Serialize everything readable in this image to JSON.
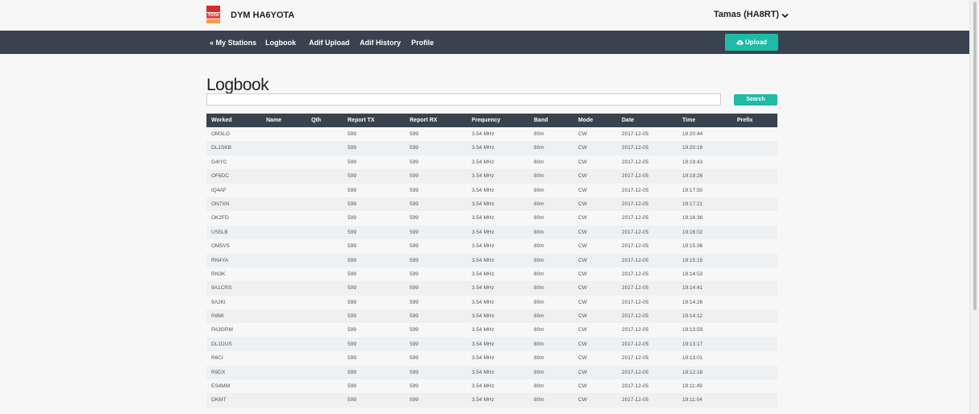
{
  "app": {
    "logo_text": "YOTA",
    "title": "DYM HA6YOTA",
    "user": "Tamas (HA8RT)"
  },
  "nav": {
    "items": [
      "« My Stations",
      "Logbook",
      "Adif Upload",
      "Adif History",
      "Profile"
    ],
    "upload_label": "Upload"
  },
  "page": {
    "title": "Logbook",
    "search_value": "",
    "search_button": "Search"
  },
  "colors": {
    "navbar": "#39424e",
    "accent": "#1fbba6",
    "row_alt": "#eef0f2"
  },
  "table": {
    "columns": [
      "Worked",
      "Name",
      "Qth",
      "Report TX",
      "Report RX",
      "Frequency",
      "Band",
      "Mode",
      "Date",
      "Time",
      "Prefix"
    ],
    "rows": [
      [
        "OM3LO",
        "",
        "",
        "599",
        "599",
        "3.54 MHz",
        "80m",
        "CW",
        "2017-12-05",
        "19:20:44",
        ""
      ],
      [
        "DL1SKB",
        "",
        "",
        "599",
        "599",
        "3.54 MHz",
        "80m",
        "CW",
        "2017-12-05",
        "19:20:19",
        ""
      ],
      [
        "G4IYC",
        "",
        "",
        "599",
        "599",
        "3.54 MHz",
        "80m",
        "CW",
        "2017-12-05",
        "19:19:43",
        ""
      ],
      [
        "OF6DC",
        "",
        "",
        "599",
        "599",
        "3.54 MHz",
        "80m",
        "CW",
        "2017-12-05",
        "19:19:26",
        ""
      ],
      [
        "IQ4AF",
        "",
        "",
        "599",
        "599",
        "3.54 MHz",
        "80m",
        "CW",
        "2017-12-05",
        "19:17:50",
        ""
      ],
      [
        "ON7XN",
        "",
        "",
        "599",
        "599",
        "3.54 MHz",
        "80m",
        "CW",
        "2017-12-05",
        "19:17:21",
        ""
      ],
      [
        "OK2FD",
        "",
        "",
        "599",
        "599",
        "3.54 MHz",
        "80m",
        "CW",
        "2017-12-05",
        "19:16:36",
        ""
      ],
      [
        "US5LB",
        "",
        "",
        "599",
        "599",
        "3.54 MHz",
        "80m",
        "CW",
        "2017-12-05",
        "19:16:02",
        ""
      ],
      [
        "OM5VS",
        "",
        "",
        "599",
        "599",
        "3.54 MHz",
        "80m",
        "CW",
        "2017-12-05",
        "19:15:36",
        ""
      ],
      [
        "RN4YA",
        "",
        "",
        "599",
        "599",
        "3.54 MHz",
        "80m",
        "CW",
        "2017-12-05",
        "19:15:15",
        ""
      ],
      [
        "RN3K",
        "",
        "",
        "599",
        "599",
        "3.54 MHz",
        "80m",
        "CW",
        "2017-12-05",
        "19:14:53",
        ""
      ],
      [
        "9A1CRS",
        "",
        "",
        "599",
        "599",
        "3.54 MHz",
        "80m",
        "CW",
        "2017-12-05",
        "19:14:41",
        ""
      ],
      [
        "9A2KI",
        "",
        "",
        "599",
        "599",
        "3.54 MHz",
        "80m",
        "CW",
        "2017-12-05",
        "19:14:26",
        ""
      ],
      [
        "R6MI",
        "",
        "",
        "599",
        "599",
        "3.54 MHz",
        "80m",
        "CW",
        "2017-12-05",
        "19:14:12",
        ""
      ],
      [
        "PA3GRM",
        "",
        "",
        "599",
        "599",
        "3.54 MHz",
        "80m",
        "CW",
        "2017-12-05",
        "19:13:59",
        ""
      ],
      [
        "DL1DUS",
        "",
        "",
        "599",
        "599",
        "3.54 MHz",
        "80m",
        "CW",
        "2017-12-05",
        "19:13:17",
        ""
      ],
      [
        "R6CI",
        "",
        "",
        "599",
        "599",
        "3.54 MHz",
        "80m",
        "CW",
        "2017-12-05",
        "19:13:01",
        ""
      ],
      [
        "R9DX",
        "",
        "",
        "599",
        "599",
        "3.54 MHz",
        "80m",
        "CW",
        "2017-12-05",
        "19:12:18",
        ""
      ],
      [
        "ES4MM",
        "",
        "",
        "599",
        "599",
        "3.54 MHz",
        "80m",
        "CW",
        "2017-12-05",
        "19:11:49",
        ""
      ],
      [
        "DK6IT",
        "",
        "",
        "599",
        "599",
        "3.54 MHz",
        "80m",
        "CW",
        "2017-12-05",
        "19:11:04",
        ""
      ]
    ]
  }
}
